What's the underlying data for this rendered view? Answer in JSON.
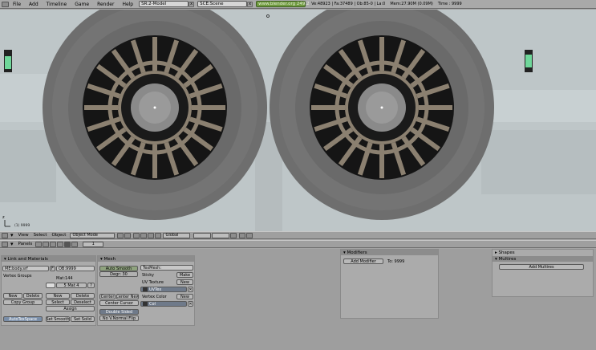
{
  "topbar": {
    "menus": [
      "File",
      "Add",
      "Timeline",
      "Game",
      "Render",
      "Help"
    ],
    "screen": "SR:2-Model",
    "scene": "SCE:Scene",
    "url": "www.blender.org 249.2",
    "stats": "Ve:48923 | Fa:37489 | Ob:85-0 | La:0",
    "mem": "Mem:27.90M (0.09M)",
    "time": "Time : 9999"
  },
  "viewport": {
    "frame_label": "(1) 9999",
    "axis_label": "z"
  },
  "view_header": {
    "menus": [
      "View",
      "Select",
      "Object"
    ],
    "mode": "Object Mode",
    "orientation": "Global"
  },
  "buttons_header": {
    "panels_label": "Panels",
    "frame": "1"
  },
  "link_materials": {
    "title": "Link and Materials",
    "me": "ME:body.srf",
    "ob": "OB:9999",
    "vertex_groups": "Vertex Groups",
    "mat_label": "Mat:144",
    "mat_slot": "5 Mat 4",
    "new": "New",
    "delete": "Delete",
    "copy_group": "Copy Group",
    "select": "Select",
    "deselect": "Deselect",
    "assign": "Assign",
    "autotexspace": "AutoTexSpace",
    "set_smooth": "Set Smooth",
    "set_solid": "Set Solid",
    "question": "?",
    "f": "F"
  },
  "mesh": {
    "title": "Mesh",
    "auto_smooth": "Auto Smooth",
    "degr": "Degr: 30",
    "texmesh": "TexMesh:",
    "sticky": "Sticky",
    "make": "Make",
    "uv_texture": "UV Texture",
    "uv_new": "New",
    "uvtex": "UVTex",
    "vertex_color": "Vertex Color",
    "vc_new": "New",
    "col": "Col",
    "center": "Center",
    "center_new": "Center New",
    "center_cursor": "Center Cursor",
    "double_sided": "Double Sided",
    "no_v_normal_flip": "No V.Normal Flip"
  },
  "modifiers": {
    "title": "Modifiers",
    "add": "Add Modifier",
    "to": "To: 9999"
  },
  "shapes": {
    "title": "Shapes"
  },
  "multires": {
    "title": "Multires",
    "add": "Add Multires"
  }
}
